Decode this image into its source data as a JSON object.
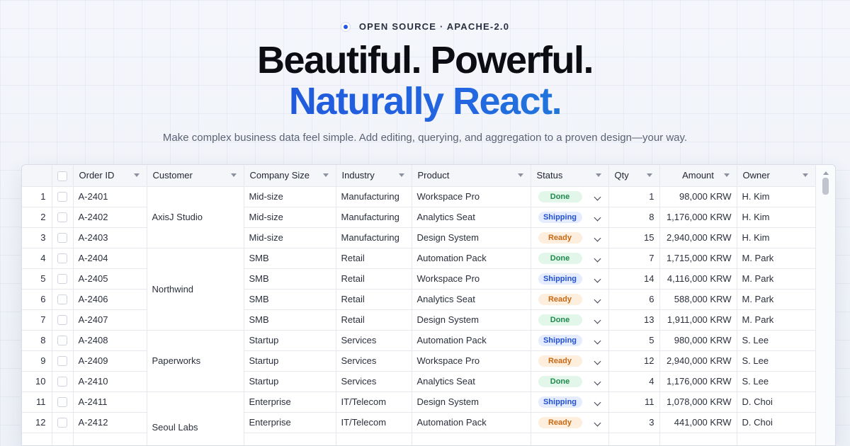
{
  "badge": "OPEN SOURCE · APACHE-2.0",
  "headline_line1": "Beautiful. Powerful.",
  "headline_line2": "Naturally React.",
  "subtitle": "Make complex business data feel simple. Add editing, querying, and aggregation to a proven design—your way.",
  "colors": {
    "accent": "#2554e6",
    "done": "#1f8a4c",
    "shipping": "#2150d6",
    "ready": "#c46a15"
  },
  "columns": [
    "Order ID",
    "Customer",
    "Company Size",
    "Industry",
    "Product",
    "Status",
    "Qty",
    "Amount",
    "Owner"
  ],
  "groups": [
    {
      "customer": "AxisJ Studio",
      "rows": [
        {
          "n": "1",
          "id": "A-2401",
          "size": "Mid-size",
          "industry": "Manufacturing",
          "product": "Workspace Pro",
          "status": "Done",
          "qty": "1",
          "amount": "98,000 KRW",
          "owner": "H. Kim"
        },
        {
          "n": "2",
          "id": "A-2402",
          "size": "Mid-size",
          "industry": "Manufacturing",
          "product": "Analytics Seat",
          "status": "Shipping",
          "qty": "8",
          "amount": "1,176,000 KRW",
          "owner": "H. Kim"
        },
        {
          "n": "3",
          "id": "A-2403",
          "size": "Mid-size",
          "industry": "Manufacturing",
          "product": "Design System",
          "status": "Ready",
          "qty": "15",
          "amount": "2,940,000 KRW",
          "owner": "H. Kim"
        }
      ]
    },
    {
      "customer": "Northwind",
      "rows": [
        {
          "n": "4",
          "id": "A-2404",
          "size": "SMB",
          "industry": "Retail",
          "product": "Automation Pack",
          "status": "Done",
          "qty": "7",
          "amount": "1,715,000 KRW",
          "owner": "M. Park"
        },
        {
          "n": "5",
          "id": "A-2405",
          "size": "SMB",
          "industry": "Retail",
          "product": "Workspace Pro",
          "status": "Shipping",
          "qty": "14",
          "amount": "4,116,000 KRW",
          "owner": "M. Park"
        },
        {
          "n": "6",
          "id": "A-2406",
          "size": "SMB",
          "industry": "Retail",
          "product": "Analytics Seat",
          "status": "Ready",
          "qty": "6",
          "amount": "588,000 KRW",
          "owner": "M. Park"
        },
        {
          "n": "7",
          "id": "A-2407",
          "size": "SMB",
          "industry": "Retail",
          "product": "Design System",
          "status": "Done",
          "qty": "13",
          "amount": "1,911,000 KRW",
          "owner": "M. Park"
        }
      ]
    },
    {
      "customer": "Paperworks",
      "rows": [
        {
          "n": "8",
          "id": "A-2408",
          "size": "Startup",
          "industry": "Services",
          "product": "Automation Pack",
          "status": "Shipping",
          "qty": "5",
          "amount": "980,000 KRW",
          "owner": "S. Lee"
        },
        {
          "n": "9",
          "id": "A-2409",
          "size": "Startup",
          "industry": "Services",
          "product": "Workspace Pro",
          "status": "Ready",
          "qty": "12",
          "amount": "2,940,000 KRW",
          "owner": "S. Lee"
        },
        {
          "n": "10",
          "id": "A-2410",
          "size": "Startup",
          "industry": "Services",
          "product": "Analytics Seat",
          "status": "Done",
          "qty": "4",
          "amount": "1,176,000 KRW",
          "owner": "S. Lee"
        }
      ]
    },
    {
      "customer": "Seoul Labs",
      "rows": [
        {
          "n": "11",
          "id": "A-2411",
          "size": "Enterprise",
          "industry": "IT/Telecom",
          "product": "Design System",
          "status": "Shipping",
          "qty": "11",
          "amount": "1,078,000 KRW",
          "owner": "D. Choi"
        },
        {
          "n": "12",
          "id": "A-2412",
          "size": "Enterprise",
          "industry": "IT/Telecom",
          "product": "Automation Pack",
          "status": "Ready",
          "qty": "3",
          "amount": "441,000 KRW",
          "owner": "D. Choi"
        }
      ]
    }
  ]
}
